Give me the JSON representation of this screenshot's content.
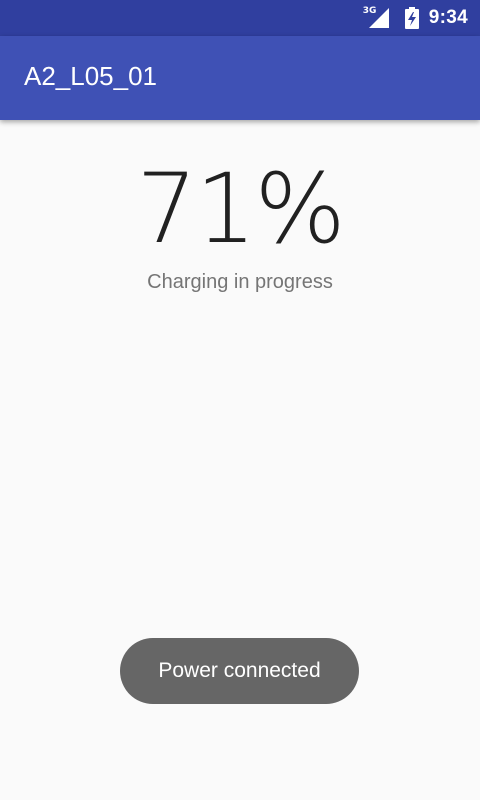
{
  "status_bar": {
    "network_type": "3G",
    "time": "9:34",
    "icons": [
      "signal-icon",
      "battery-charging-icon"
    ]
  },
  "app_bar": {
    "title": "A2_L05_01"
  },
  "battery": {
    "percent_text": "71%",
    "status_text": "Charging in progress"
  },
  "toast": {
    "message": "Power connected"
  },
  "colors": {
    "status_bar": "#303f9f",
    "app_bar": "#3f51b5",
    "background": "#fafafa",
    "percent_text": "#212121",
    "status_text": "#757575",
    "toast_bg": "#666666"
  }
}
